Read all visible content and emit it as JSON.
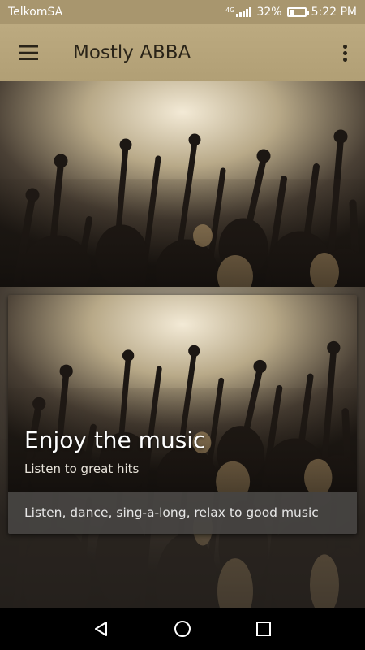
{
  "status_bar": {
    "carrier": "TelkomSA",
    "network_type": "4G",
    "battery_percent": "32%",
    "battery_level": 0.32,
    "time": "5:22 PM"
  },
  "app_bar": {
    "title": "Mostly ABBA",
    "menu_icon": "hamburger-menu-icon",
    "overflow_icon": "more-vert-icon"
  },
  "card": {
    "title": "Enjoy the music",
    "subtitle": "Listen to great hits",
    "description": "Listen, dance, sing-a-long, relax to good music"
  },
  "nav_bar": {
    "back_icon": "back-triangle-icon",
    "home_icon": "home-circle-icon",
    "recents_icon": "recents-square-icon"
  },
  "colors": {
    "app_bar": "#b5a37a",
    "status_bar": "#a8966e",
    "card_footer": "#464442"
  }
}
